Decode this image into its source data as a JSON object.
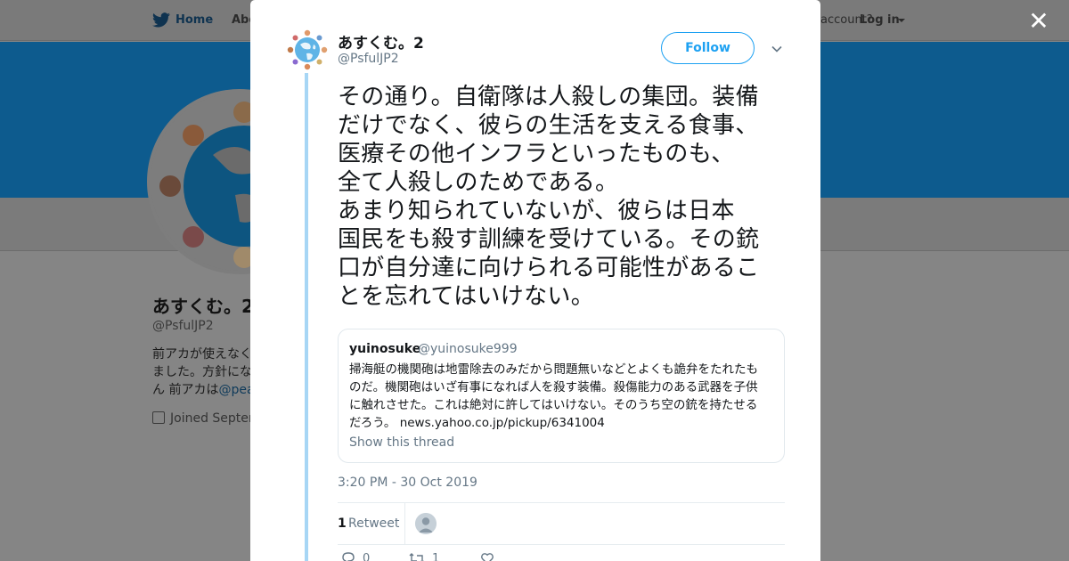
{
  "background_page": {
    "nav": {
      "home_label": "Home",
      "about_label": "Abo",
      "account_prompt": "account?",
      "login_label": "Log in"
    },
    "profile": {
      "name": "あすくむ。2",
      "handle": "@PsfulJP2",
      "bio_line1": "前アカが使えなく",
      "bio_line2": "ました。方針にな",
      "bio_line3_text": "ん 前アカは",
      "bio_line3_link": "@pea",
      "joined": "Joined Septen"
    }
  },
  "modal": {
    "close_icon": "close-icon",
    "author": {
      "name": "あすくむ。2",
      "handle": "@PsfulJP2"
    },
    "follow_label": "Follow",
    "tweet_lines": [
      "その通り。自衛隊は人殺しの集団。装備",
      "だけでなく、彼らの生活を支える食事、",
      "医療その他インフラといったものも、",
      "全て人殺しのためである。",
      "あまり知られていないが、彼らは日本",
      "国民をも殺す訓練を受けている。その銃",
      "口が自分達に向けられる可能性があるこ",
      "とを忘れてはいけない。"
    ],
    "quote": {
      "name": "yuinosuke",
      "handle": "@yuinosuke999",
      "text_lines": [
        "掃海艇の機関砲は地雷除去のみだから問題無いなどとよくも詭弁をたれたも",
        "のだ。機関砲はいざ有事になれば人を殺す装備。殺傷能力のある武器を子供",
        "に触れさせた。これは絶対に許してはいけない。そのうち空の銃を持たせる",
        "だろう。"
      ],
      "link": "news.yahoo.co.jp/pickup/6341004",
      "show_thread": "Show this thread"
    },
    "timestamp": "3:20 PM - 30 Oct 2019",
    "retweet_count": "1",
    "retweet_label": "Retweet",
    "actions": {
      "reply_count": "0",
      "retweet_count": "1"
    },
    "colors": {
      "accent": "#1da1f2",
      "thread_line": "#a7d6f5",
      "muted": "#657786"
    }
  }
}
